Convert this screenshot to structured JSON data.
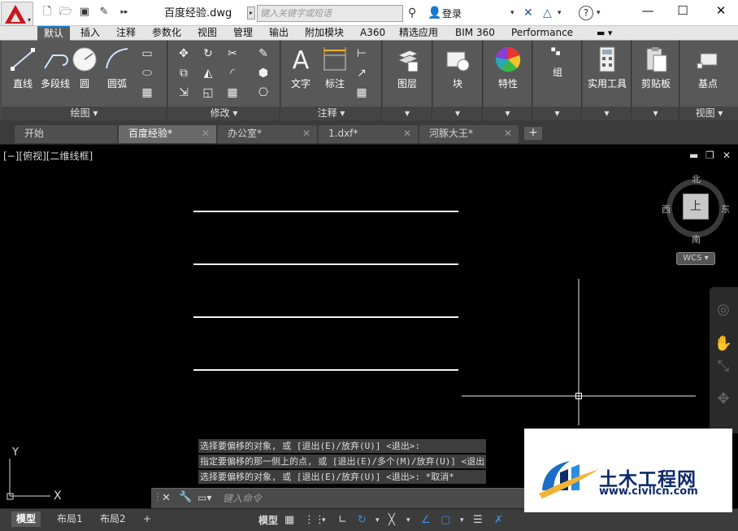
{
  "title_bar": {
    "file_name": "百度经验.dwg",
    "search_placeholder": "键入关键字或短语",
    "login_label": "登录",
    "help_label": "?"
  },
  "ribbon_tabs": [
    "默认",
    "插入",
    "注释",
    "参数化",
    "视图",
    "管理",
    "输出",
    "附加模块",
    "A360",
    "精选应用",
    "BIM 360",
    "Performance"
  ],
  "ribbon": {
    "draw_panel": {
      "title": "绘图 ▾",
      "buttons": [
        "直线",
        "多段线",
        "圆",
        "圆弧"
      ]
    },
    "modify_panel": {
      "title": "修改 ▾"
    },
    "annotation_panel": {
      "title": "注释 ▾",
      "buttons": [
        "文字",
        "标注"
      ]
    },
    "layers_label": "图层",
    "block_label": "块",
    "properties_label": "特性",
    "group_label": "组",
    "utilities_label": "实用工具",
    "clipboard_label": "剪贴板",
    "basepoint_label": "基点",
    "view_panel_title": "视图 ▾"
  },
  "doc_tabs": [
    "开始",
    "百度经验*",
    "办公室*",
    "1.dxf*",
    "河豚大王*"
  ],
  "viewport": {
    "label": "[−][俯视][二维线框]",
    "compass": {
      "north": "北",
      "south": "南",
      "east": "东",
      "west": "西",
      "face": "上"
    },
    "wcs_label": "WCS ▾"
  },
  "command_history": [
    "选择要偏移的对象, 或 [退出(E)/放弃(U)] <退出>:",
    "指定要偏移的那一侧上的点, 或 [退出(E)/多个(M)/放弃(U)] <退出",
    "选择要偏移的对象, 或 [退出(E)/放弃(U)] <退出>:  *取消*"
  ],
  "command_input_placeholder": "键入命令",
  "status_bar": {
    "layout_tabs": [
      "模型",
      "布局1",
      "布局2"
    ],
    "model_label": "模型"
  },
  "watermark": {
    "brand": "土木工程网",
    "url": "www.civilcn.com"
  },
  "colors": {
    "ribbon_bg": "#585858",
    "active_tab_accent": "#1a7ad0",
    "canvas_bg": "#000000",
    "logo_red": "#c8181e",
    "watermark_blue": "#0d2a6b"
  }
}
